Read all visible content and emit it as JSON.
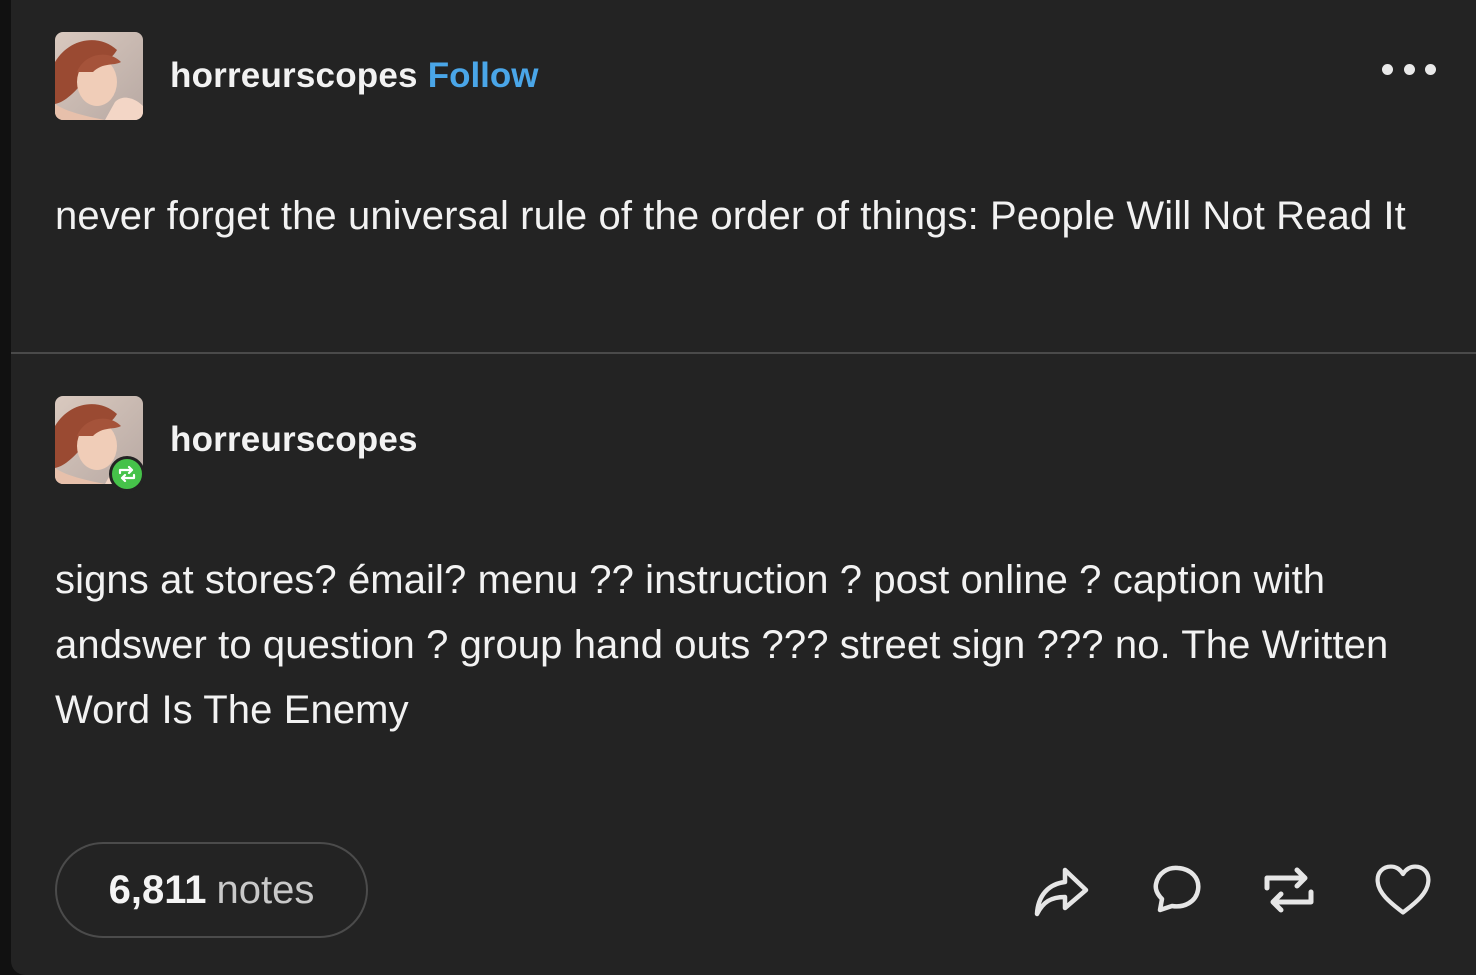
{
  "post": {
    "username": "horreurscopes",
    "follow_label": "Follow",
    "text": "never forget the universal rule of the order of things: People Will Not Read It"
  },
  "reblog": {
    "username": "horreurscopes",
    "text": "signs at stores? émail? menu ?? instruction ? post online ? caption with andswer to question ? group hand outs ??? street sign ??? no. The Written Word Is The Enemy"
  },
  "footer": {
    "notes_count": "6,811",
    "notes_label": "notes"
  },
  "icons": {
    "more": "more-dots-icon",
    "share": "share-icon",
    "reply": "reply-icon",
    "reblog": "reblog-icon",
    "like": "heart-icon"
  },
  "colors": {
    "background": "#232323",
    "follow": "#4aa6e8",
    "reblog_badge": "#46c24a"
  }
}
